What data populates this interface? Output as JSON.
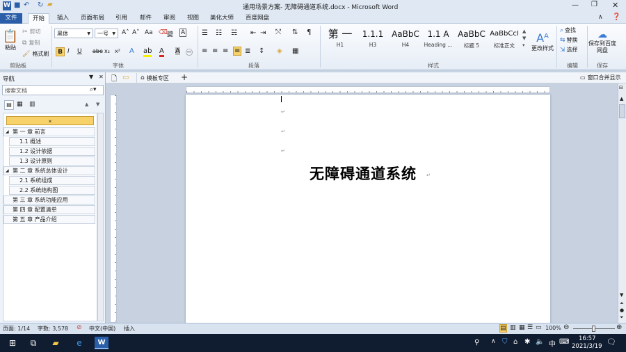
{
  "window": {
    "title": "通用场景方案- 无障碍通道系统.docx - Microsoft Word"
  },
  "tabs": [
    "文件",
    "开始",
    "插入",
    "页面布局",
    "引用",
    "邮件",
    "审阅",
    "视图",
    "美化大师",
    "百度网盘"
  ],
  "clipboard": {
    "paste": "粘贴",
    "cut": "剪切",
    "copy": "复制",
    "format_painter": "格式刷",
    "label": "剪贴板"
  },
  "font": {
    "family": "黑体",
    "size": "一号",
    "label": "字体"
  },
  "paragraph": {
    "label": "段落"
  },
  "styles": {
    "items": [
      {
        "sample": "第 一",
        "name": "H1"
      },
      {
        "sample": "1.1.1",
        "name": "H3"
      },
      {
        "sample": "AaBbC",
        "name": "H4"
      },
      {
        "sample": "1.1 A",
        "name": "Heading ..."
      },
      {
        "sample": "AaBbC",
        "name": "标题 5"
      },
      {
        "sample": "AaBbCcI",
        "name": "标准正文"
      }
    ],
    "change": "更改样式",
    "label": "样式"
  },
  "editing": {
    "find": "查找",
    "replace": "替换",
    "select": "选择",
    "label": "编辑"
  },
  "save": {
    "button": "保存到百度网盘",
    "label": "保存"
  },
  "nav": {
    "title": "导航",
    "search_placeholder": "搜索文档",
    "items": [
      {
        "text": "第 一 章 前言",
        "level": 1
      },
      {
        "text": "1.1 概述",
        "level": 2
      },
      {
        "text": "1.2 设计依据",
        "level": 2
      },
      {
        "text": "1.3 设计原则",
        "level": 2
      },
      {
        "text": "第 二 章 系统总体设计",
        "level": 1
      },
      {
        "text": "2.1 系统组成",
        "level": 2
      },
      {
        "text": "2.2 系统结构图",
        "level": 2
      },
      {
        "text": "第 三 章 系统功能应用",
        "level": 1
      },
      {
        "text": "第 四 章 配置清单",
        "level": 1
      },
      {
        "text": "第 五 章 产品介绍",
        "level": 1
      }
    ]
  },
  "doctabs": {
    "template_zone": "模板专区",
    "window_merge": "窗口合并显示"
  },
  "document": {
    "heading": "无障碍通道系统"
  },
  "status": {
    "page": "页面: 1/14",
    "words": "字数: 3,578",
    "language": "中文(中国)",
    "mode": "插入",
    "zoom": "100%"
  },
  "taskbar": {
    "input_method": "中",
    "time": "16:57",
    "date": "2021/3/19"
  },
  "colors": {
    "file_tab": "#2a5ea8",
    "highlight": "#f7d26a",
    "taskbar": "#101c30"
  }
}
